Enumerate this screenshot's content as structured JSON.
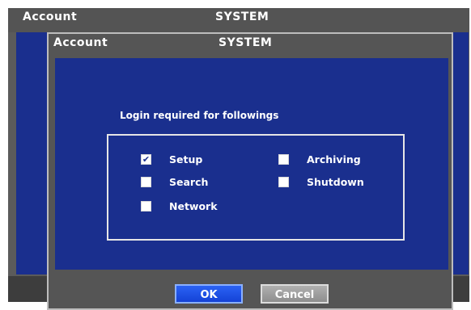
{
  "background": {
    "title_left": "Account",
    "title_center": "SYSTEM"
  },
  "dialog": {
    "title_left": "Account",
    "title_center": "SYSTEM",
    "prompt": "Login required for followings",
    "options": [
      {
        "label": "Setup",
        "checked": true
      },
      {
        "label": "Search",
        "checked": false
      },
      {
        "label": "Network",
        "checked": false
      },
      {
        "label": "Archiving",
        "checked": false
      },
      {
        "label": "Shutdown",
        "checked": false
      }
    ],
    "ok_label": "OK",
    "cancel_label": "Cancel",
    "check_glyph": "✔"
  },
  "colors": {
    "panel_blue": "#1a2f8e",
    "frame_gray": "#555555",
    "ok_blue": "#1f52e6",
    "cancel_gray": "#9e9e9e"
  }
}
